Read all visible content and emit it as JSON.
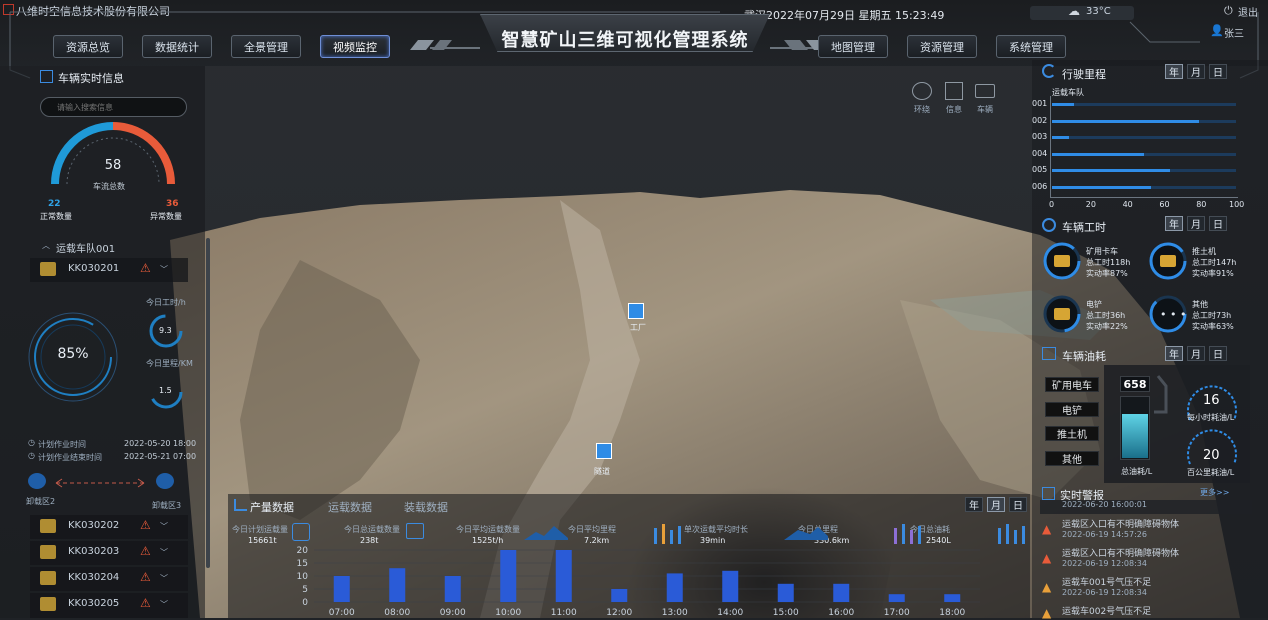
{
  "company": "八维时空信息技术股份有限公司",
  "datetime": "武汉2022年07月29日 星期五 15:23:49",
  "weather": {
    "temp": "33°C"
  },
  "user": {
    "logout": "退出",
    "name": "张三"
  },
  "system_title": "智慧矿山三维可视化管理系统",
  "nav_left": [
    "资源总览",
    "数据统计",
    "全景管理",
    "视频监控"
  ],
  "nav_right": [
    "地图管理",
    "资源管理",
    "系统管理"
  ],
  "vehicle_info": {
    "title": "车辆实时信息",
    "search_placeholder": "请输入搜索信息",
    "total_value": "58",
    "total_label": "车流总数",
    "normal_value": "22",
    "normal_label": "正常数量",
    "abnormal_value": "36",
    "abnormal_label": "异常数量",
    "fleet": "运载车队001",
    "vehicles": [
      "KK030201",
      "KK030202",
      "KK030203",
      "KK030204",
      "KK030205"
    ],
    "percent": "85%",
    "work_today_label": "今日工时/h",
    "work_today_value": "9.3",
    "mileage_today_label": "今日里程/KM",
    "mileage_today_value": "1.5",
    "plan_start_label": "计划作业时间",
    "plan_start_value": "2022-05-20 18:00",
    "plan_end_label": "计划作业结束时间",
    "plan_end_value": "2022-05-21 07:00",
    "unload_left": "卸载区2",
    "unload_right": "卸载区3"
  },
  "scene": {
    "tools": [
      "环绕",
      "信息",
      "车辆"
    ],
    "markers": [
      "工厂",
      "隧道"
    ]
  },
  "mileage": {
    "title": "行驶里程",
    "tabs": [
      "年",
      "月",
      "日"
    ],
    "series_label": "运载车队",
    "rows": [
      "001",
      "002",
      "003",
      "004",
      "005",
      "006"
    ],
    "values": [
      12,
      80,
      9,
      50,
      64,
      54
    ],
    "axis": [
      "0",
      "20",
      "40",
      "60",
      "80",
      "100"
    ]
  },
  "worktime": {
    "title": "车辆工时",
    "tabs": [
      "年",
      "月",
      "日"
    ],
    "items": [
      {
        "name": "矿用卡车",
        "total": "总工时118h",
        "rate": "实动率87%",
        "icon": "mining-truck-icon"
      },
      {
        "name": "推土机",
        "total": "总工时147h",
        "rate": "实动率91%",
        "icon": "bulldozer-icon"
      },
      {
        "name": "电铲",
        "total": "总工时36h",
        "rate": "实动率22%",
        "icon": "excavator-icon"
      },
      {
        "name": "其他",
        "total": "总工时73h",
        "rate": "实动率63%",
        "icon": "more-icon"
      }
    ]
  },
  "fuel": {
    "title": "车辆油耗",
    "tabs": [
      "年",
      "月",
      "日"
    ],
    "types": [
      "矿用电车",
      "电铲",
      "推土机",
      "其他"
    ],
    "total_value": "658",
    "total_label": "总油耗/L",
    "hour_value": "16",
    "hour_label": "每小时耗油/L",
    "km_value": "20",
    "km_label": "百公里耗油/L"
  },
  "production": {
    "tabs": [
      "产量数据",
      "运载数据",
      "装载数据"
    ],
    "period": [
      "年",
      "月",
      "日"
    ],
    "stats": [
      {
        "label": "今日计划运载量",
        "value": "15661t"
      },
      {
        "label": "今日总运载数量",
        "value": "238t"
      },
      {
        "label": "今日平均运载数量",
        "value": "1525t/h"
      },
      {
        "label": "今日平均里程",
        "value": "7.2km"
      },
      {
        "label": "单次运载平均时长",
        "value": "39min"
      },
      {
        "label": "今日总里程",
        "value": "330.6km"
      },
      {
        "label": "今日总油耗",
        "value": "2540L"
      }
    ]
  },
  "alerts": {
    "title": "实时警报",
    "more": "更多>>",
    "items": [
      {
        "text": "",
        "time": "2022-06-20 16:00:01"
      },
      {
        "text": "运载区入口有不明确障碍物体",
        "time": "2022-06-19 14:57:26"
      },
      {
        "text": "运载区入口有不明确障碍物体",
        "time": "2022-06-19 12:08:34"
      },
      {
        "text": "运载车001号气压不足",
        "time": "2022-06-19 12:08:34"
      },
      {
        "text": "运载车002号气压不足",
        "time": ""
      }
    ]
  },
  "chart_data": {
    "type": "bar",
    "categories": [
      "07:00",
      "08:00",
      "09:00",
      "10:00",
      "11:00",
      "12:00",
      "13:00",
      "14:00",
      "15:00",
      "16:00",
      "17:00",
      "18:00"
    ],
    "values": [
      10,
      13,
      10,
      20,
      20,
      5,
      11,
      12,
      7,
      7,
      3,
      3
    ],
    "yticks": [
      "0",
      "5",
      "10",
      "15",
      "20"
    ],
    "ylim": [
      0,
      20
    ],
    "grid": true,
    "color": "#2a5bd7"
  },
  "colors": {
    "accent": "#2f8ce6",
    "warning": "#e85b3a",
    "bar": "#2a5bd7"
  }
}
